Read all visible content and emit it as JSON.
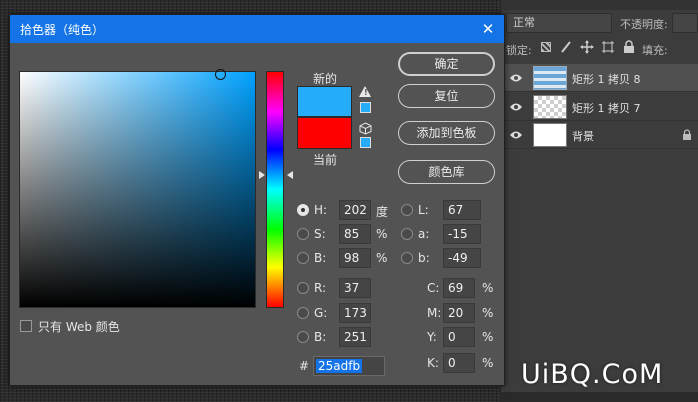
{
  "dialog": {
    "title": "拾色器（纯色）",
    "close_glyph": "✕",
    "new_label": "新的",
    "current_label": "当前",
    "buttons": {
      "ok": "确定",
      "reset": "复位",
      "add_to_swatches": "添加到色板",
      "color_libraries": "颜色库"
    },
    "fields": {
      "H": {
        "label": "H:",
        "value": "202",
        "unit": "度"
      },
      "S": {
        "label": "S:",
        "value": "85",
        "unit": "%"
      },
      "B": {
        "label": "B:",
        "value": "98",
        "unit": "%"
      },
      "R": {
        "label": "R:",
        "value": "37"
      },
      "G": {
        "label": "G:",
        "value": "173"
      },
      "Bb": {
        "label": "B:",
        "value": "251"
      },
      "L": {
        "label": "L:",
        "value": "67"
      },
      "a": {
        "label": "a:",
        "value": "-15"
      },
      "b": {
        "label": "b:",
        "value": "-49"
      },
      "C": {
        "label": "C:",
        "value": "69",
        "unit": "%"
      },
      "M": {
        "label": "M:",
        "value": "20",
        "unit": "%"
      },
      "Y": {
        "label": "Y:",
        "value": "0",
        "unit": "%"
      },
      "K": {
        "label": "K:",
        "value": "0",
        "unit": "%"
      }
    },
    "hex_label": "#",
    "hex_value": "25adfb",
    "web_only_label": "只有 Web 颜色",
    "colors": {
      "new": "#25adfb",
      "current": "#ff0000",
      "accent": "#1473e6"
    }
  },
  "layers_panel": {
    "blend_mode": "正常",
    "opacity_label": "不透明度:",
    "lock_label": "锁定:",
    "fill_label": "填充:",
    "layers": [
      {
        "name": "矩形 1 拷贝 8",
        "active": true,
        "thumb": "stripes-blue"
      },
      {
        "name": "矩形 1 拷贝 7",
        "active": false,
        "thumb": "transparent"
      },
      {
        "name": "背景",
        "active": false,
        "thumb": "white",
        "locked": true
      }
    ]
  },
  "watermark": "UiBQ.CoM"
}
